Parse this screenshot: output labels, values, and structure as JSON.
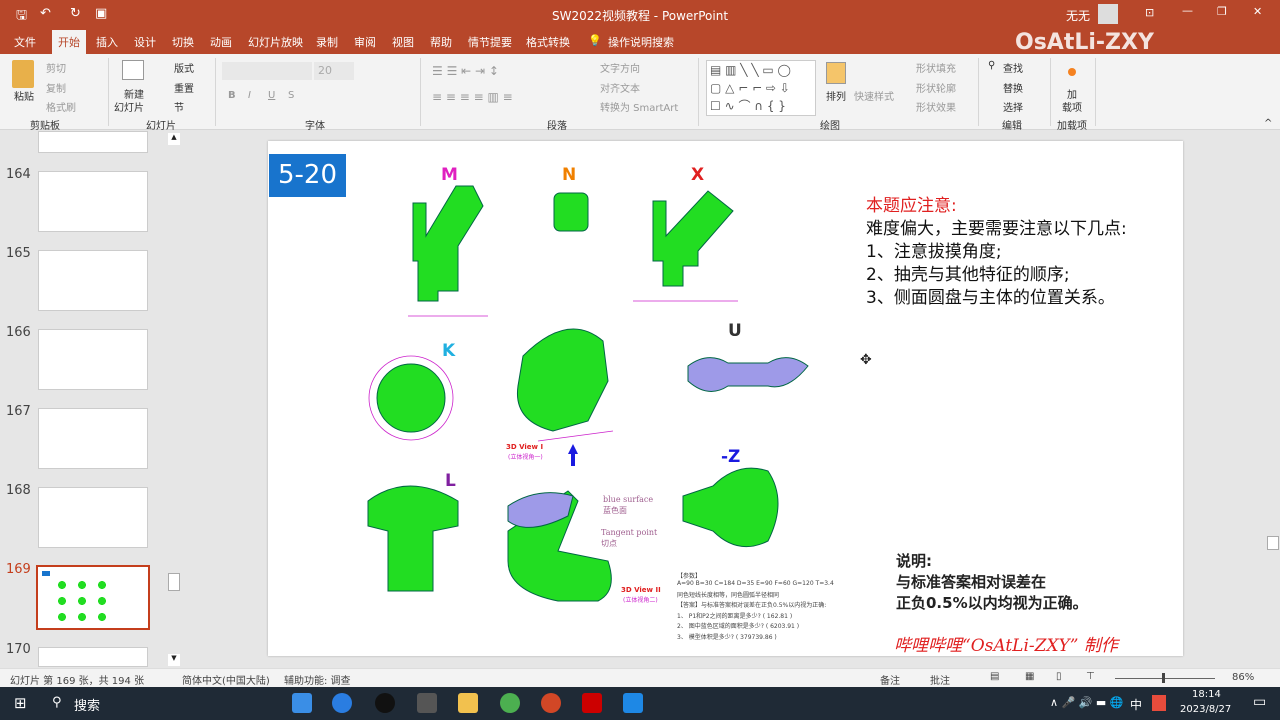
{
  "window": {
    "title": "SW2022视频教程 - PowerPoint",
    "user": "无无",
    "watermark": "OsAtLi-ZXY"
  },
  "tabs": [
    "文件",
    "开始",
    "插入",
    "设计",
    "切换",
    "动画",
    "幻灯片放映",
    "录制",
    "审阅",
    "视图",
    "帮助",
    "情节提要",
    "格式转换",
    "操作说明搜索"
  ],
  "active_tab": "开始",
  "ribbon": {
    "clipboard": {
      "paste": "粘贴",
      "cut": "剪切",
      "copy": "复制",
      "format_painter": "格式刷",
      "label": "剪贴板"
    },
    "slides": {
      "new_slide_1": "新建",
      "new_slide_2": "幻灯片",
      "layout": "版式",
      "reset": "重置",
      "section": "节",
      "label": "幻灯片"
    },
    "font": {
      "size": "20",
      "label": "字体"
    },
    "paragraph": {
      "text_direction": "文字方向",
      "align_text": "对齐文本",
      "smartart": "转换为 SmartArt",
      "label": "段落"
    },
    "drawing": {
      "arrange": "排列",
      "quick_styles": "快速样式",
      "shape_fill": "形状填充",
      "shape_outline": "形状轮廓",
      "shape_effects": "形状效果",
      "label": "绘图"
    },
    "editing": {
      "find": "查找",
      "replace": "替换",
      "select": "选择",
      "label": "编辑"
    },
    "addins": {
      "addins_1": "加",
      "addins_2": "载项",
      "label": "加载项"
    }
  },
  "thumbnails": [
    {
      "num": "164"
    },
    {
      "num": "165"
    },
    {
      "num": "166"
    },
    {
      "num": "167"
    },
    {
      "num": "168"
    },
    {
      "num": "169",
      "selected": true
    },
    {
      "num": "170"
    }
  ],
  "slide": {
    "number_badge": "5-20",
    "view_labels": {
      "M": "M",
      "N": "N",
      "X": "X",
      "K": "K",
      "U": "U",
      "L": "L",
      "Z": "-Z"
    },
    "view1": "3D View I",
    "view1_cn": "(立体视角一)",
    "view2": "3D View II",
    "view2_cn": "(立体视角二)",
    "blue_surface": "blue surface",
    "blue_surface_cn": "蓝色面",
    "tangent_point": "Tangent point",
    "tangent_point_cn": "切点",
    "notes_title": "本题应注意:",
    "notes": [
      "难度偏大，主要需要注意以下几点:",
      "1、注意拔摸角度;",
      "2、抽壳与其他特征的顺序;",
      "3、侧面圆盘与主体的位置关系。"
    ],
    "params_title": "【参数】",
    "params": "A=90   B=30   C=184   D=35   E=90   F=60   G=120   T=3.4",
    "params_note": "同色短线长度相等，同色圆弧半径相同",
    "answer_title": "【答案】与标准答案相对误差在正负0.5%以内视为正确:",
    "questions": [
      "1、 P1和P2之间的距离是多少?  ( 162.81 )",
      "2、 图中蓝色区域的面积是多少?  ( 6203.91 )",
      "3、 模型体积是多少?  ( 379739.86 )"
    ],
    "explain_title": "说明:",
    "explain": [
      "与标准答案相对误差在",
      "正负0.5%以内均视为正确。"
    ],
    "credit": "哔哩哔哩“OsAtLi-ZXY” 制作"
  },
  "status": {
    "slide_info": "幻灯片 第 169 张，共 194 张",
    "language": "简体中文(中国大陆)",
    "accessibility": "辅助功能: 调查",
    "notes": "备注",
    "comments": "批注",
    "zoom": "86%",
    "zoom_level": 0.86
  },
  "taskbar": {
    "search": "搜索",
    "time": "18:14",
    "date": "2023/8/27",
    "ime": "中"
  },
  "colors": {
    "accent": "#b7472a",
    "green": "#22dd22",
    "badge": "#1874cd",
    "red": "#e02020"
  }
}
